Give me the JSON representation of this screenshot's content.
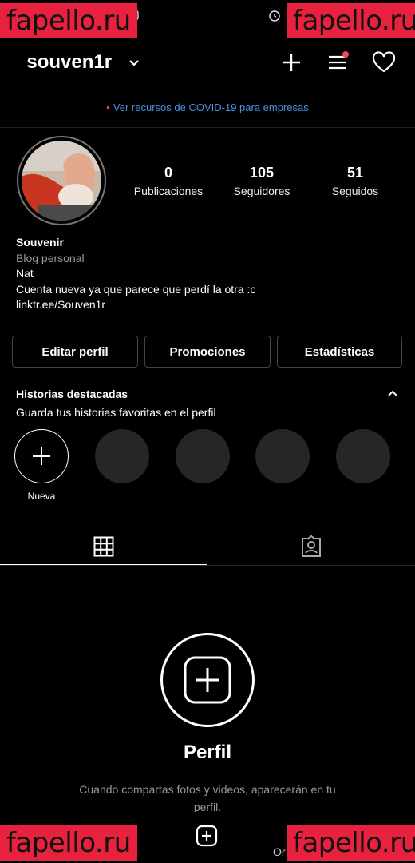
{
  "watermark": {
    "text": "fapello.ru"
  },
  "header": {
    "username": "_souven1r_",
    "icons": [
      "chevron-down-icon",
      "plus-icon",
      "menu-icon",
      "heart-icon"
    ],
    "notification_color": "#ed4956"
  },
  "covid_banner": {
    "text": "Ver recursos de COVID-19 para empresas",
    "link_color": "#4a8fe0"
  },
  "profile": {
    "stats": [
      {
        "value": "0",
        "label": "Publicaciones"
      },
      {
        "value": "105",
        "label": "Seguidores"
      },
      {
        "value": "51",
        "label": "Seguidos"
      }
    ],
    "name": "Souvenir",
    "category": "Blog personal",
    "bio_line1": "Nat",
    "bio_line2": "Cuenta nueva ya que parece que perdí la otra :c",
    "link": "linktr.ee/Souven1r"
  },
  "buttons": {
    "edit": "Editar perfil",
    "promos": "Promociones",
    "stats": "Estadísticas"
  },
  "highlights": {
    "title": "Historias destacadas",
    "subtitle": "Guarda tus historias favoritas en el perfil",
    "new_label": "Nueva"
  },
  "tabs": [
    "grid-icon",
    "tagged-icon"
  ],
  "empty_state": {
    "title": "Perfil",
    "text": "Cuando compartas fotos y videos, aparecerán en tu perfil."
  },
  "bottom_nav": {
    "partial_label": "Or"
  }
}
